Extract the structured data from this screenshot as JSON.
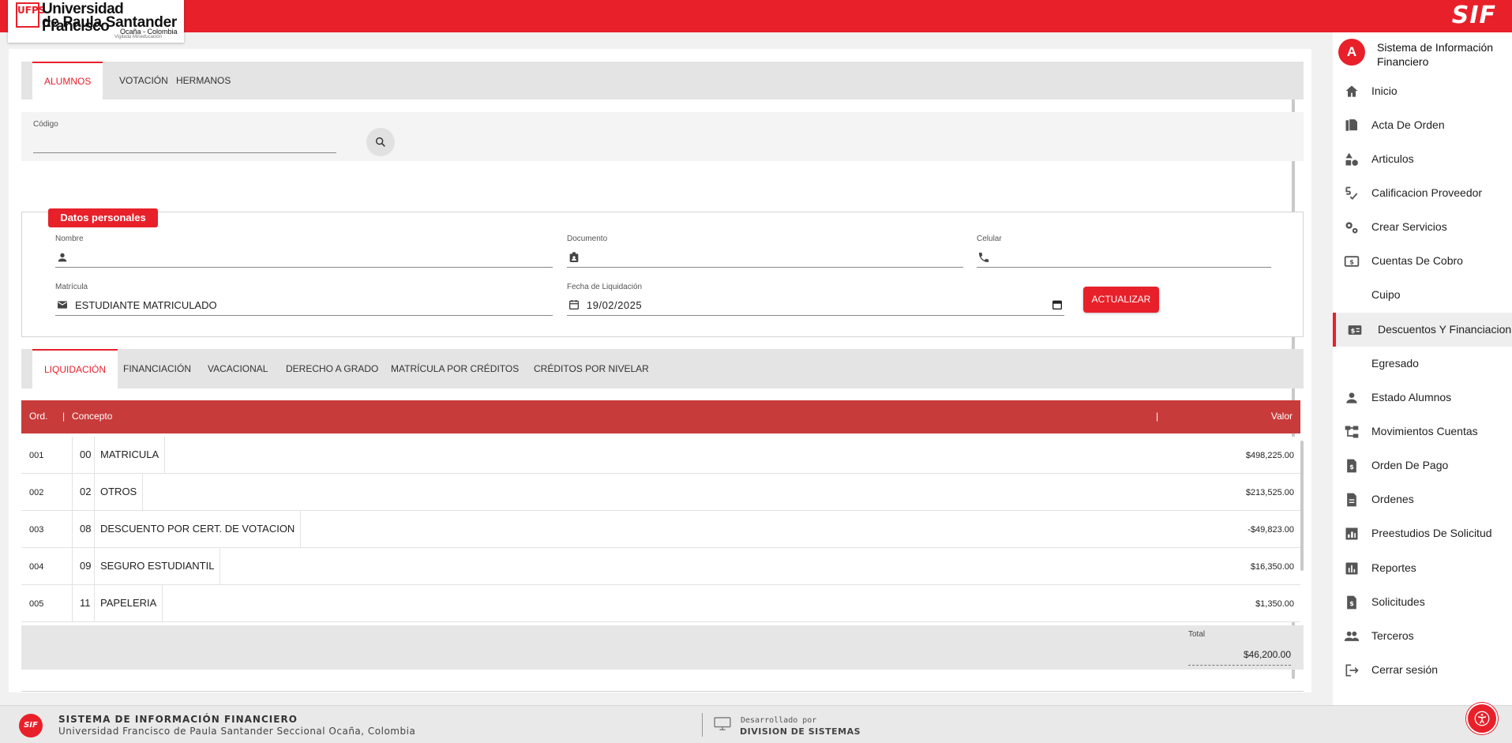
{
  "brand": {
    "university_line1": "Universidad Francisco",
    "university_line2": "de Paula Santander",
    "campus": "Ocaña - Colombia",
    "vigilance": "Vigilada Mineducación",
    "logo_mark": "UFPS",
    "app_short": "SIF",
    "accent_color": "#e8202a"
  },
  "top_tabs": [
    {
      "label": "ALUMNOS",
      "active": true
    },
    {
      "label": "VOTACIÓN",
      "active": false
    },
    {
      "label": "HERMANOS",
      "active": false
    }
  ],
  "search": {
    "label": "Código",
    "value": "",
    "icon": "search-icon"
  },
  "personal": {
    "legend": "Datos personales",
    "nombre_label": "Nombre",
    "nombre_value": "",
    "documento_label": "Documento",
    "documento_value": "",
    "celular_label": "Celular",
    "celular_value": "",
    "matricula_label": "Matrícula",
    "matricula_value": "ESTUDIANTE MATRICULADO",
    "fecha_label": "Fecha de Liquidación",
    "fecha_value": "19/02/2025",
    "update_button": "ACTUALIZAR"
  },
  "sub_tabs": [
    {
      "label": "LIQUIDACIÓN",
      "active": true
    },
    {
      "label": "FINANCIACIÓN",
      "active": false
    },
    {
      "label": "VACACIONAL",
      "active": false
    },
    {
      "label": "DERECHO A GRADO",
      "active": false
    },
    {
      "label": "MATRÍCULA POR CRÉDITOS",
      "active": false
    },
    {
      "label": "CRÉDITOS POR NIVELAR",
      "active": false
    }
  ],
  "table": {
    "headers": {
      "ord": "Ord.",
      "concepto": "Concepto",
      "valor": "Valor"
    },
    "rows": [
      {
        "ord": "001",
        "code": "00",
        "concept": "MATRICULA",
        "value": "$498,225.00"
      },
      {
        "ord": "002",
        "code": "02",
        "concept": "OTROS",
        "value": "$213,525.00"
      },
      {
        "ord": "003",
        "code": "08",
        "concept": "DESCUENTO POR CERT. DE VOTACION",
        "value": "-$49,823.00"
      },
      {
        "ord": "004",
        "code": "09",
        "concept": "SEGURO ESTUDIANTIL",
        "value": "$16,350.00"
      },
      {
        "ord": "005",
        "code": "11",
        "concept": "PAPELERIA",
        "value": "$1,350.00"
      }
    ],
    "total_label": "Total",
    "total_value": "$46,200.00"
  },
  "sidebar": {
    "avatar_letter": "A",
    "title": "Sistema de Información Financiero",
    "items": [
      {
        "label": "Inicio",
        "icon": "home-icon",
        "active": false
      },
      {
        "label": "Acta De Orden",
        "icon": "document-copy-icon",
        "active": false
      },
      {
        "label": "Articulos",
        "icon": "shapes-icon",
        "active": false
      },
      {
        "label": "Calificacion Proveedor",
        "icon": "rating-check-icon",
        "active": false
      },
      {
        "label": "Crear Servicios",
        "icon": "settings-gears-icon",
        "active": false
      },
      {
        "label": "Cuentas De Cobro",
        "icon": "money-bill-icon",
        "active": false
      },
      {
        "label": "Cuipo",
        "icon": "",
        "active": false
      },
      {
        "label": "Descuentos Y Financiacion D",
        "icon": "money-discount-icon",
        "active": true
      },
      {
        "label": "Egresado",
        "icon": "",
        "active": false
      },
      {
        "label": "Estado Alumnos",
        "icon": "person-icon",
        "active": false
      },
      {
        "label": "Movimientos Cuentas",
        "icon": "account-tree-icon",
        "active": false
      },
      {
        "label": "Orden De Pago",
        "icon": "money-document-icon",
        "active": false
      },
      {
        "label": "Ordenes",
        "icon": "document-icon",
        "active": false
      },
      {
        "label": "Preestudios De Solicitud",
        "icon": "report-chart-icon",
        "active": false
      },
      {
        "label": "Reportes",
        "icon": "bar-chart-icon",
        "active": false
      },
      {
        "label": "Solicitudes",
        "icon": "money-request-icon",
        "active": false
      },
      {
        "label": "Terceros",
        "icon": "group-icon",
        "active": false
      },
      {
        "label": "Cerrar sesión",
        "icon": "logout-icon",
        "active": false
      }
    ]
  },
  "footer": {
    "logo": "SIF",
    "title": "SISTEMA DE INFORMACIÓN FINANCIERO",
    "subtitle": "Universidad Francisco de Paula Santander Seccional Ocaña, Colombia",
    "dev_label": "Desarrollado por",
    "dev_name": "DIVISION DE SISTEMAS"
  }
}
